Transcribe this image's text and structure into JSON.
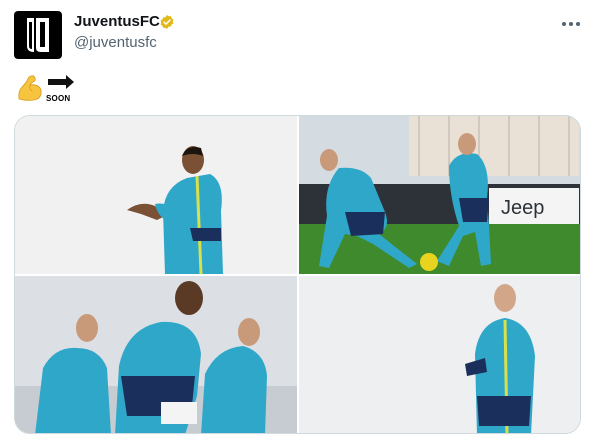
{
  "tweet": {
    "display_name": "JuventusFC",
    "handle": "@juventusfc",
    "verified": true,
    "menu_icon": "more-horizontal-icon",
    "avatar_icon": "juventus-logo",
    "body": {
      "emoji_1": "flexed-biceps-emoji",
      "emoji_2": "soon-arrow-emoji",
      "soon_text": "SOON"
    },
    "media": [
      {
        "label": "photo-player-clapping"
      },
      {
        "label": "photo-players-ball-drill"
      },
      {
        "label": "photo-players-running"
      },
      {
        "label": "photo-player-standing"
      }
    ]
  },
  "colors": {
    "verified_gold": "#e2b719",
    "handle_gray": "#536471",
    "jersey_teal": "#2fa7c9",
    "shorts_navy": "#1b2f5c",
    "pitch_green": "#3f8a2c",
    "ball_yellow": "#e8d31f"
  }
}
